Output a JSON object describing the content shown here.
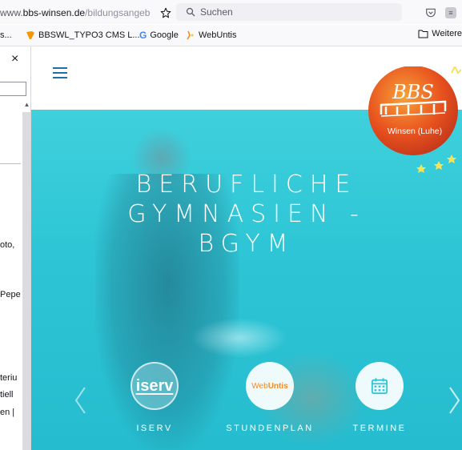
{
  "browser": {
    "url_prefix": "www.",
    "url_host": "bbs-winsen.de",
    "url_path": "/bildungsangeb",
    "search_placeholder": "Suchen",
    "bookmarks": [
      "s...",
      "BBSWL_TYPO3 CMS L...",
      "Google",
      "WebUntis"
    ],
    "other_bookmarks": "Weitere"
  },
  "sidebar": {
    "close_glyph": "×",
    "fragments": [
      "oto,",
      "Pepe",
      "teriu",
      "tiell",
      "en |"
    ]
  },
  "hero": {
    "title_lines": [
      "BERUFLICHE",
      "GYMNASIEN -",
      "BGYM"
    ],
    "quicklinks": [
      {
        "label": "ISERV",
        "logo_text": "iserv"
      },
      {
        "label": "STUNDENPLAN",
        "logo_prefix": "Web",
        "logo_suffix": "Untis"
      },
      {
        "label": "TERMINE"
      }
    ]
  },
  "logo": {
    "text": "BBS",
    "subtitle": "Winsen (Luhe)"
  },
  "colors": {
    "hero": "#2ec6d6",
    "hamburger": "#1f6fa8",
    "logo_orange": "#e8521e",
    "webuntis_orange": "#f28c28"
  }
}
